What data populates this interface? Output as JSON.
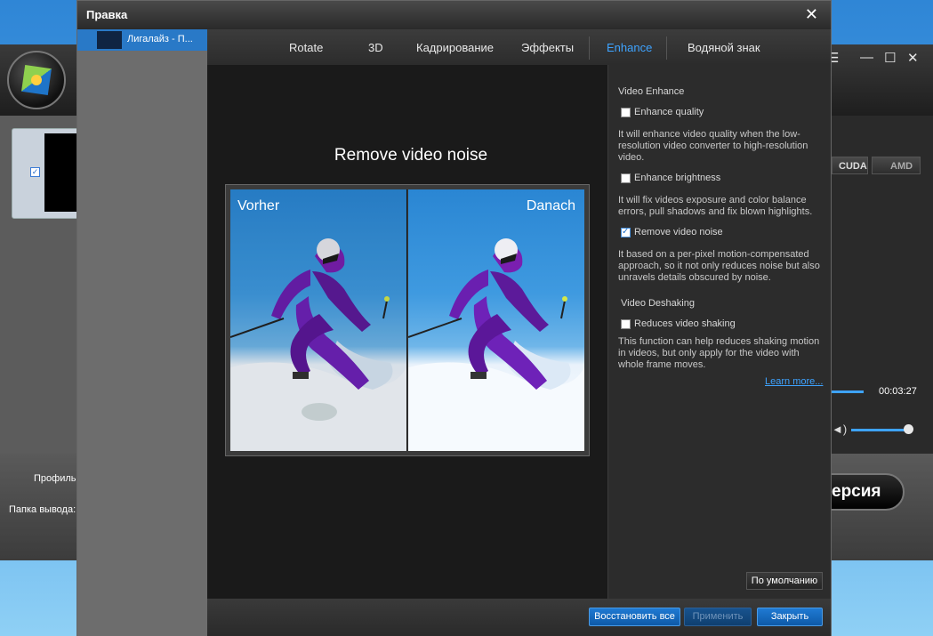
{
  "background_app": {
    "window_controls": [
      "☰",
      "—",
      "☐",
      "✕"
    ],
    "gpu_buttons": {
      "cuda": "CUDA",
      "amd": "AMD"
    },
    "duration": "00:03:27",
    "profile_label": "Профиль:",
    "output_folder_label": "Папка вывода:",
    "convert_button": "ерсия"
  },
  "dialog": {
    "title": "Правка",
    "close_symbol": "✕",
    "file_list": [
      {
        "name": "Лигалайз - П..."
      }
    ],
    "tabs": [
      {
        "label": "Rotate",
        "active": false
      },
      {
        "label": "3D",
        "active": false
      },
      {
        "label": "Кадрирование",
        "active": false
      },
      {
        "label": "Эффекты",
        "active": false
      },
      {
        "label": "Enhance",
        "active": true
      },
      {
        "label": "Водяной знак",
        "active": false
      }
    ],
    "preview": {
      "title": "Remove video noise",
      "before_label": "Vorher",
      "after_label": "Danach"
    },
    "settings": {
      "video_enhance_heading": "Video Enhance",
      "enhance_quality": {
        "label": "Enhance quality",
        "checked": false,
        "description": "It will enhance video quality when the low-resolution video converter to high-resolution video."
      },
      "enhance_brightness": {
        "label": "Enhance brightness",
        "checked": false,
        "description": "It will fix videos exposure and color balance errors, pull shadows and fix blown highlights."
      },
      "remove_noise": {
        "label": "Remove video noise",
        "checked": true,
        "description": "It based on a per-pixel motion-compensated approach, so it not only reduces noise but also unravels details obscured by noise."
      },
      "video_deshaking_heading": "Video Deshaking",
      "reduce_shaking": {
        "label": "Reduces video shaking",
        "checked": false,
        "description": "This function can help reduces shaking motion in videos, but only apply for the video with whole frame moves."
      },
      "learn_more": "Learn more...",
      "default_button": "По умолчанию"
    },
    "footer": {
      "restore_all": "Восстановить все",
      "apply": "Применить",
      "close": "Закрыть"
    }
  },
  "colors": {
    "accent": "#3ea3ff",
    "button_blue": "#1670c4"
  }
}
